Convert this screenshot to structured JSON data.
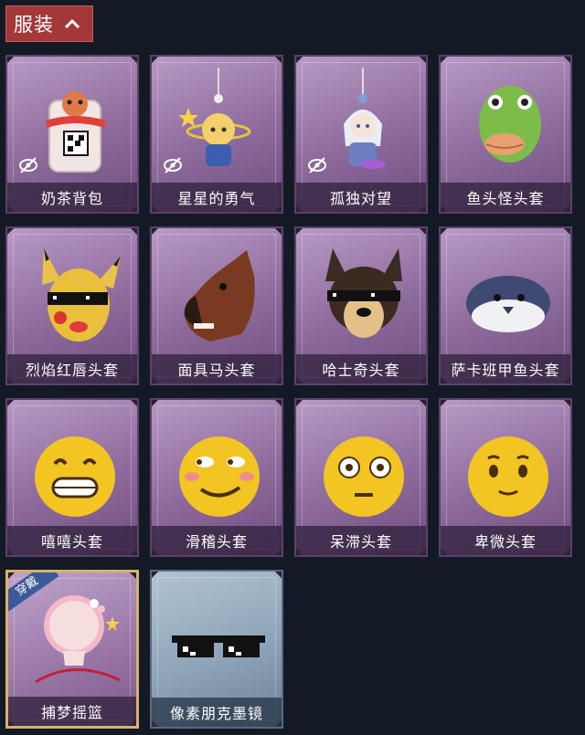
{
  "header": {
    "title": "服装",
    "icon": "chevron-up-icon",
    "color": "#a43838"
  },
  "items": [
    {
      "label": "奶茶背包",
      "hidden_icon": true,
      "icon": "milk-tea-backpack-icon"
    },
    {
      "label": "星星的勇气",
      "hidden_icon": true,
      "icon": "star-keychain-icon"
    },
    {
      "label": "孤独对望",
      "hidden_icon": true,
      "icon": "doll-keychain-icon"
    },
    {
      "label": "鱼头怪头套",
      "hidden_icon": false,
      "icon": "fish-head-mask-icon"
    },
    {
      "label": "烈焰红唇头套",
      "hidden_icon": false,
      "icon": "yellow-creature-mask-icon"
    },
    {
      "label": "面具马头套",
      "hidden_icon": false,
      "icon": "horse-mask-icon"
    },
    {
      "label": "哈士奇头套",
      "hidden_icon": false,
      "icon": "husky-mask-icon"
    },
    {
      "label": "萨卡班甲鱼头套",
      "hidden_icon": false,
      "icon": "sacabambaspis-mask-icon"
    },
    {
      "label": "嘻嘻头套",
      "hidden_icon": false,
      "icon": "grin-emoji-mask-icon"
    },
    {
      "label": "滑稽头套",
      "hidden_icon": false,
      "icon": "funny-emoji-mask-icon"
    },
    {
      "label": "呆滞头套",
      "hidden_icon": false,
      "icon": "stunned-emoji-mask-icon"
    },
    {
      "label": "卑微头套",
      "hidden_icon": false,
      "icon": "timid-emoji-mask-icon"
    },
    {
      "label": "捕梦摇篮",
      "hidden_icon": false,
      "icon": "dream-cradle-icon",
      "badge": "穿戴"
    },
    {
      "label": "像素朋克墨镜",
      "hidden_icon": false,
      "icon": "pixel-sunglasses-icon"
    }
  ]
}
